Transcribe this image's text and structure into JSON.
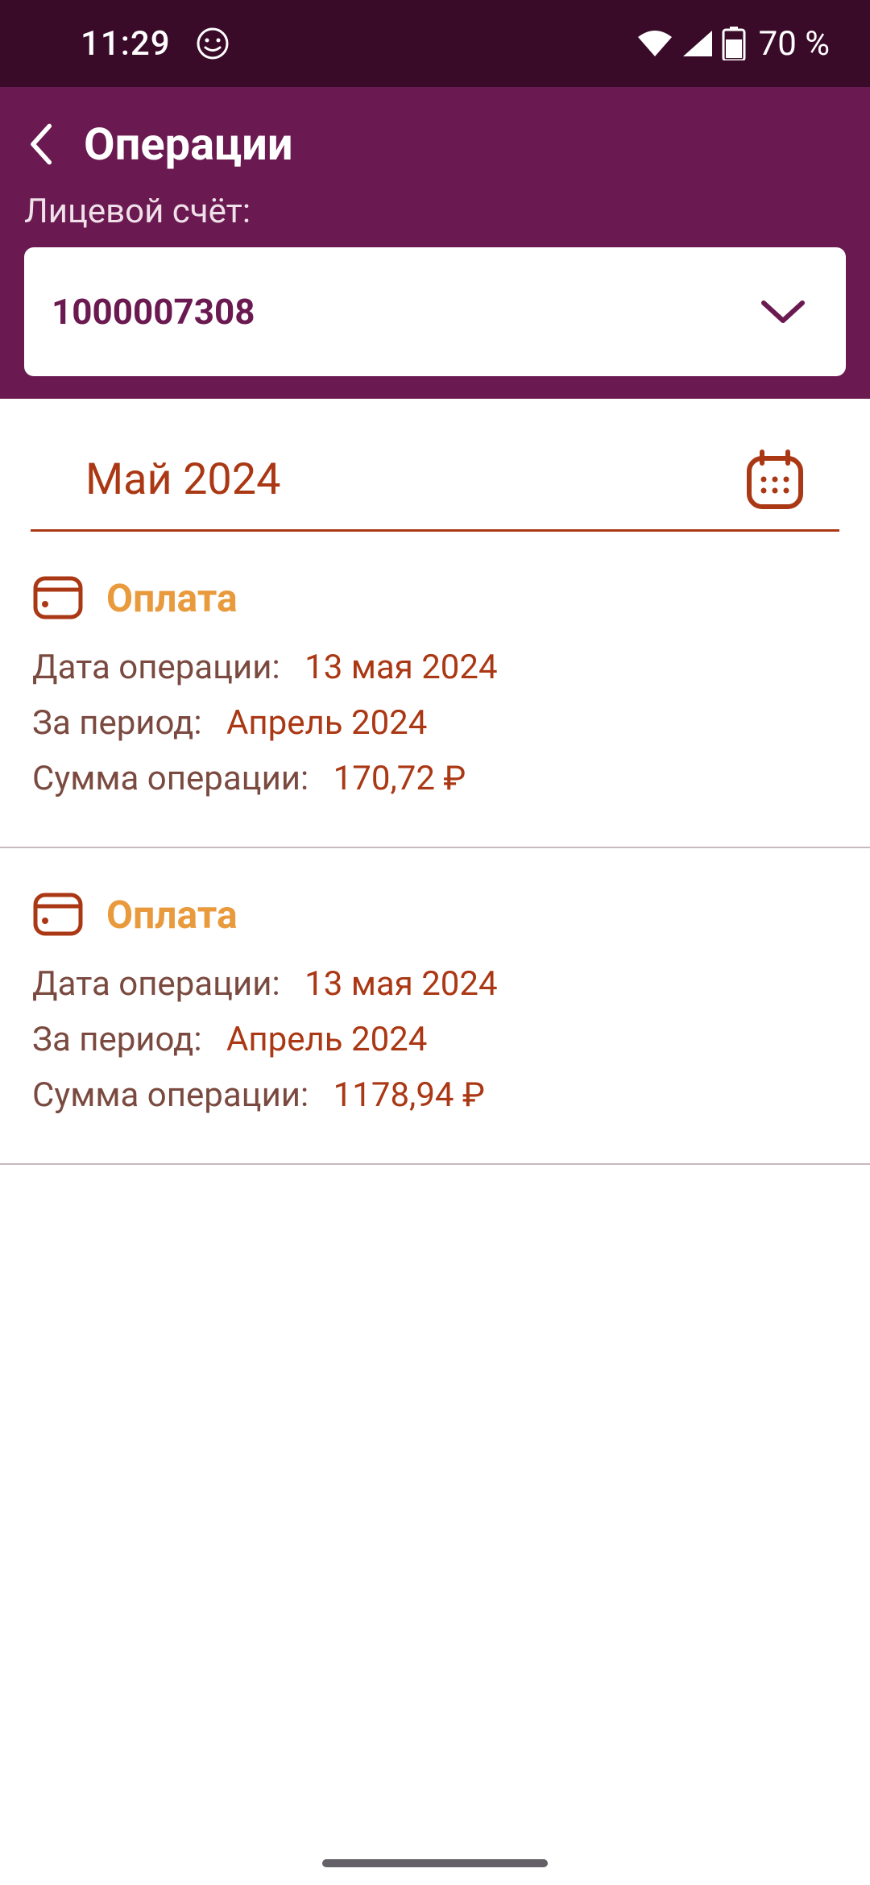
{
  "status": {
    "time": "11:29",
    "battery": "70 %"
  },
  "header": {
    "title": "Операции",
    "account_label": "Лицевой счёт:",
    "account_number": "1000007308"
  },
  "month": {
    "label": "Май 2024"
  },
  "labels": {
    "date": "Дата операции:",
    "period": "За период:",
    "amount": "Сумма операции:"
  },
  "operations": [
    {
      "type": "Оплата",
      "date": "13 мая 2024",
      "period": "Апрель 2024",
      "amount": "170,72 ₽"
    },
    {
      "type": "Оплата",
      "date": "13 мая 2024",
      "period": "Апрель 2024",
      "amount": "1178,94 ₽"
    }
  ]
}
